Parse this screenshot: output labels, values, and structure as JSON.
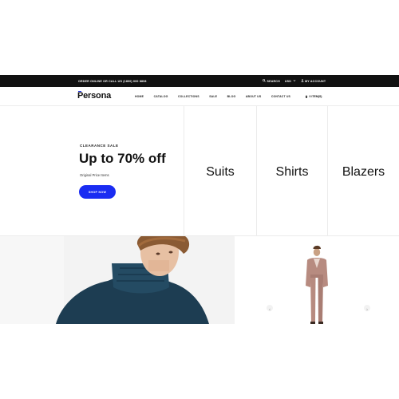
{
  "topbar": {
    "promo": "ORDER ONLINE OR CALL US (1800) 000 8808",
    "search_label": "SEARCH",
    "currency_label": "USD",
    "account_label": "MY ACCOUNT"
  },
  "header": {
    "logo": "Persona",
    "nav": [
      "HOME",
      "CATALOG",
      "COLLECTIONS",
      "SALE",
      "BLOG",
      "ABOUT US",
      "CONTACT US"
    ],
    "cart_label": "0 ITEM(S)"
  },
  "hero": {
    "eyebrow": "CLEARANCE SALE",
    "headline": "Up to 70% off",
    "subtext": "Original Price Items",
    "cta": "SHOP NOW",
    "categories": [
      "Suits",
      "Shirts",
      "Blazers"
    ]
  },
  "colors": {
    "accent": "#1a2cf2",
    "topbar_bg": "#111111",
    "divider": "#ececec"
  },
  "icons": [
    "search-icon",
    "chevron-down-icon",
    "user-icon",
    "cart-icon",
    "arrow-left-icon",
    "arrow-right-icon"
  ]
}
